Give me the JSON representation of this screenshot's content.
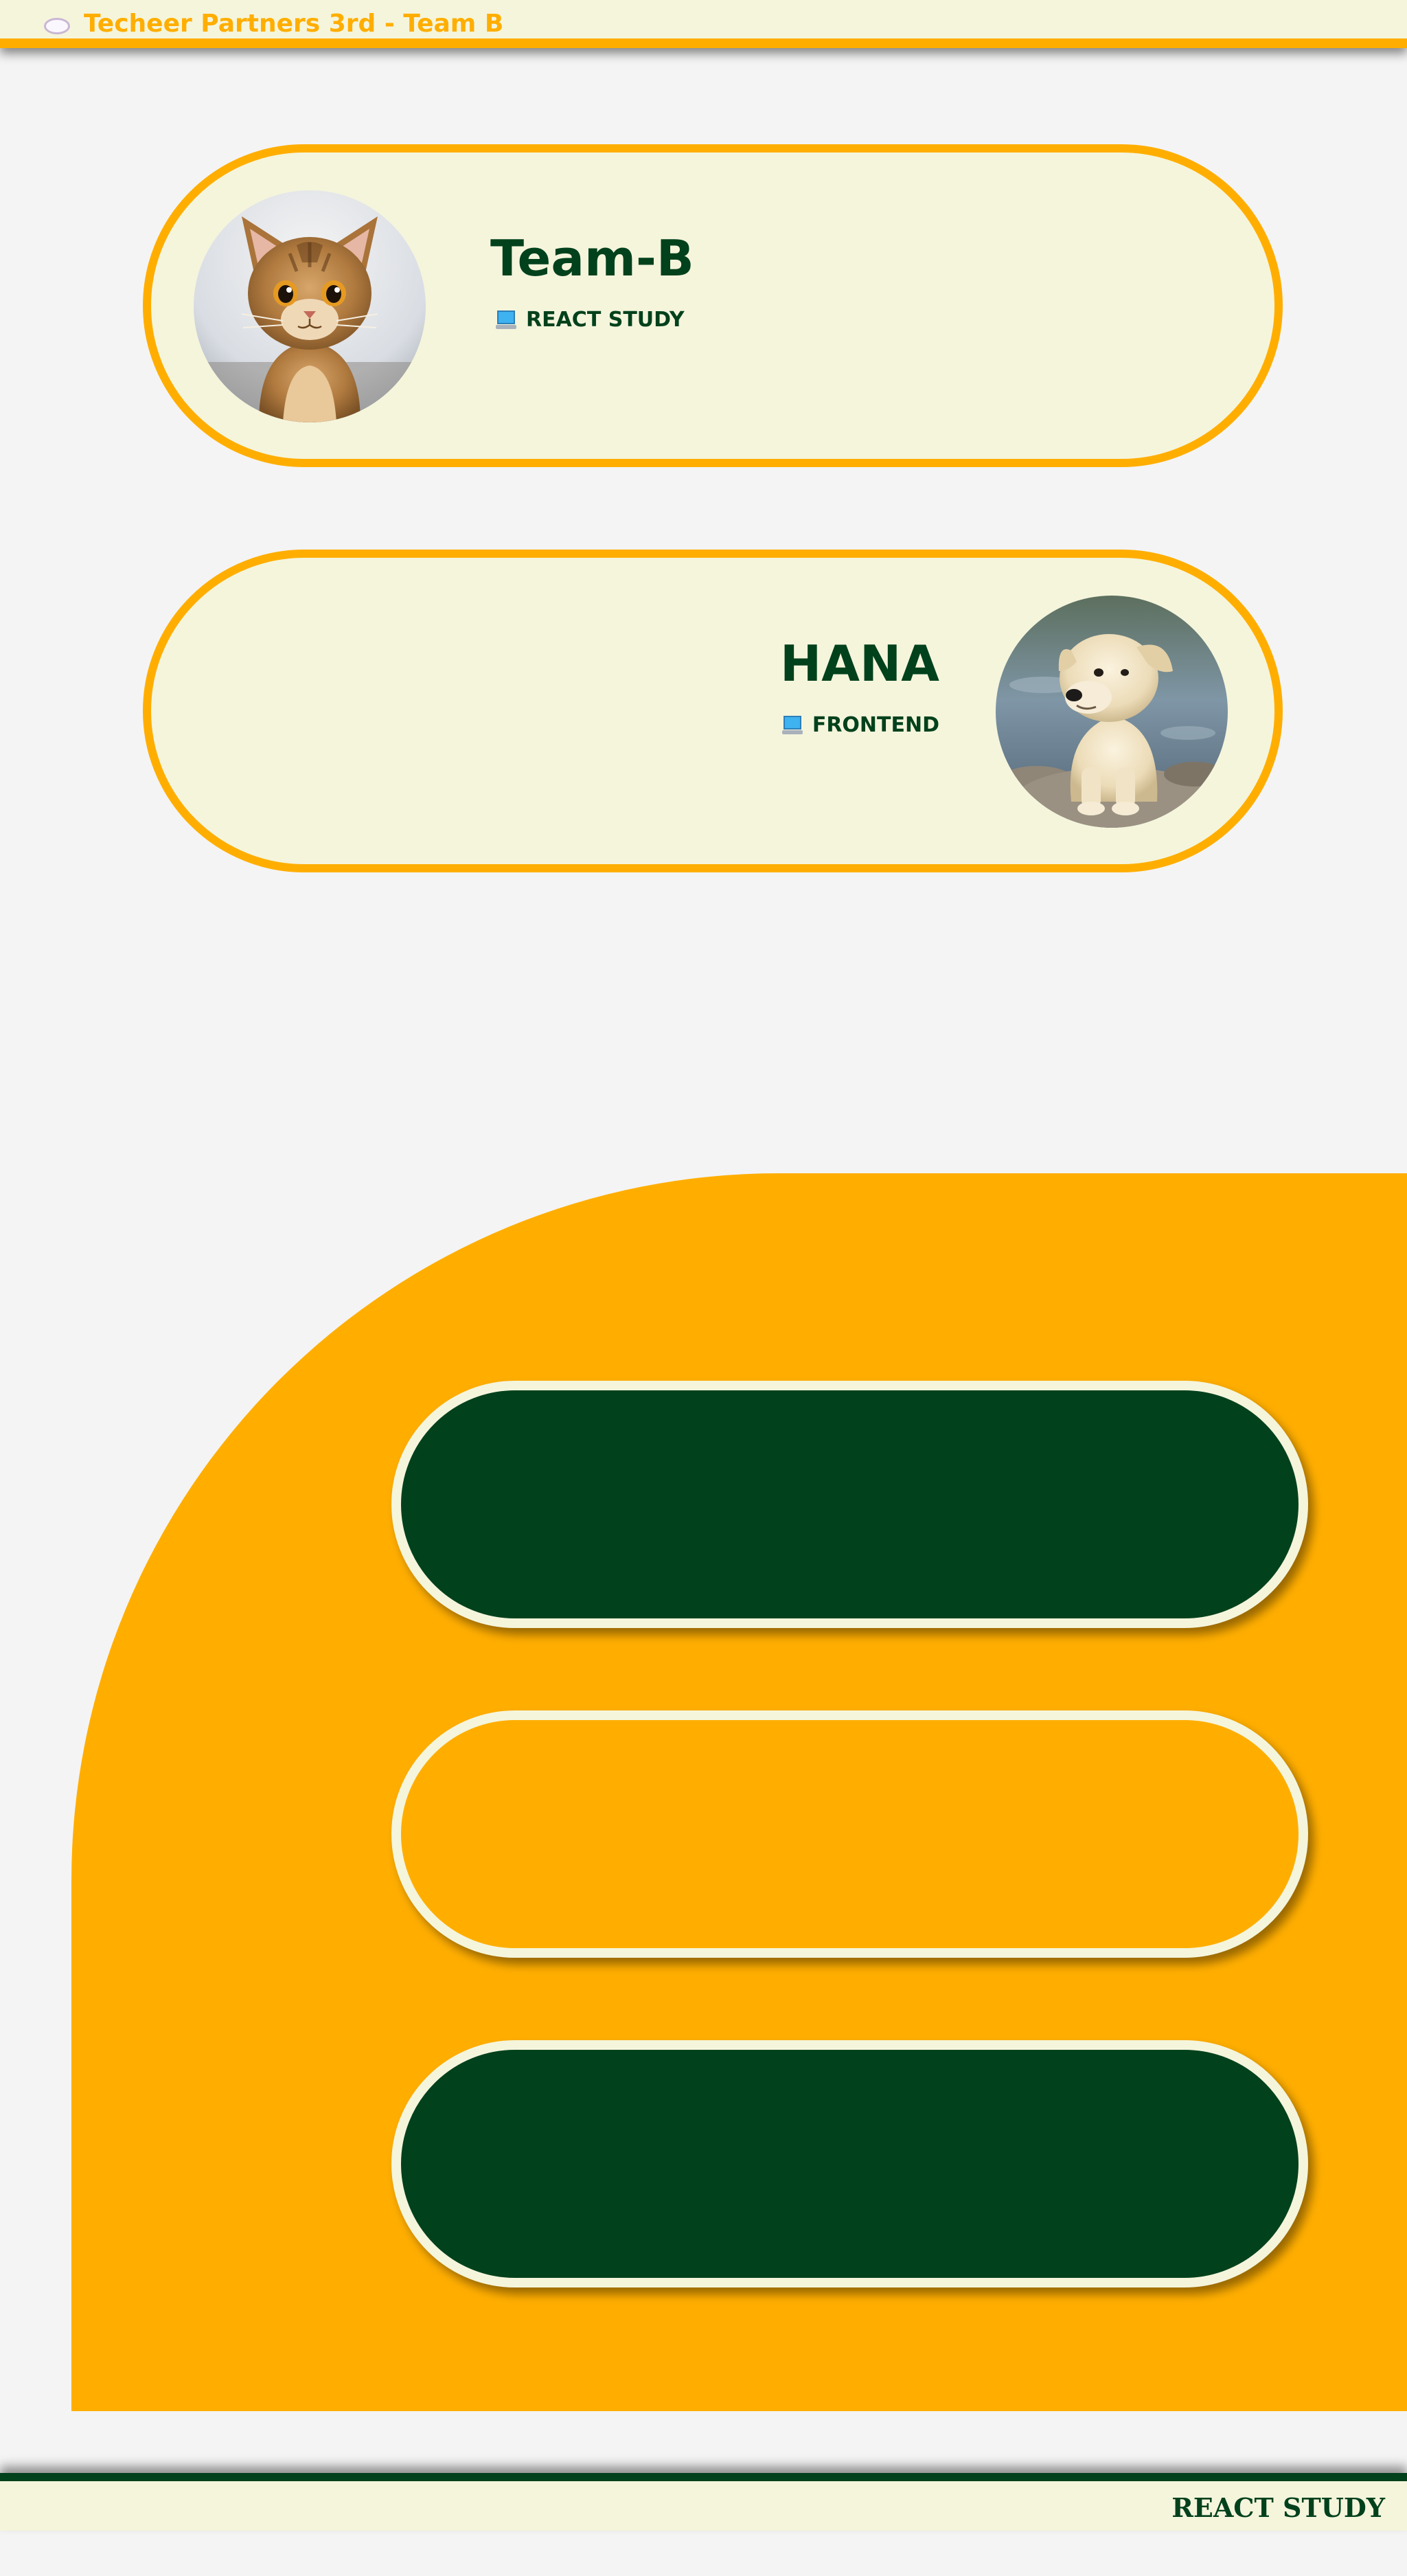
{
  "header": {
    "title": "Techeer Partners 3rd - Team B",
    "logo_icon": "cloud-icon"
  },
  "cards": [
    {
      "title": "Team-B",
      "subtitle": "REACT STUDY",
      "subtitle_icon": "laptop-icon",
      "photo": "kitten-photo"
    },
    {
      "title": "HANA",
      "subtitle": "FRONTEND",
      "subtitle_icon": "laptop-icon",
      "photo": "puppy-photo"
    }
  ],
  "menu_buttons": [
    {
      "label": "",
      "style": "filled-green"
    },
    {
      "label": "",
      "style": "filled-yellow"
    },
    {
      "label": "",
      "style": "filled-green"
    }
  ],
  "footer": {
    "text": "REACT STUDY"
  },
  "colors": {
    "accent": "#ffae00",
    "dark_green": "#01411c",
    "cream": "#f5f5dc",
    "background": "#f4f4f4"
  }
}
